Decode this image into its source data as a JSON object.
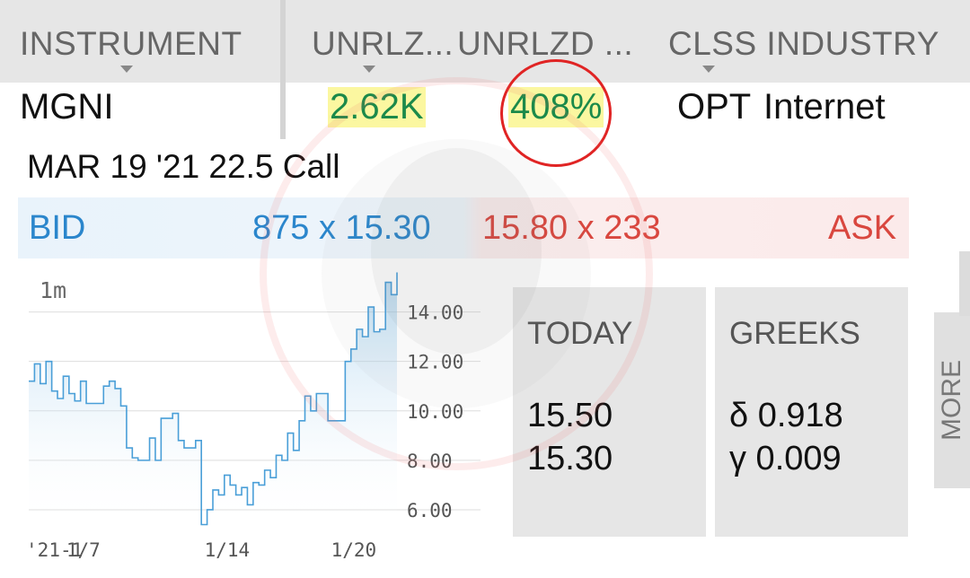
{
  "header": {
    "col_instrument": "INSTRUMENT",
    "col_unrlz_short": "UNRLZ...",
    "col_unrlzd": "UNRLZD ...",
    "col_clss_industry": "CLSS INDUSTRY"
  },
  "row": {
    "instrument": "MGNI",
    "unrlz": "2.62K",
    "unrlzd": "408%",
    "clss": "OPT",
    "industry": "Internet"
  },
  "contract": "MAR 19 '21 22.5 Call",
  "quote": {
    "bid_label": "BID",
    "bid_value": "875 x 15.30",
    "ask_value": "15.80 x 233",
    "ask_label": "ASK"
  },
  "chart_data": {
    "type": "area",
    "timeframe": "1m",
    "x_ticks": [
      "'21-1",
      "1/7",
      "1/14",
      "1/20"
    ],
    "y_ticks": [
      "14.00",
      "12.00",
      "10.00",
      "8.00",
      "6.00"
    ],
    "ylim": [
      5.2,
      15.8
    ],
    "grid": true,
    "series": [
      {
        "values": [
          11.2,
          11.9,
          11.1,
          12.0,
          10.8,
          10.5,
          11.4,
          10.7,
          10.4,
          11.2,
          10.3,
          10.3,
          10.3,
          11.0,
          11.2,
          10.9,
          10.2,
          8.5,
          8.1,
          8.0,
          8.0,
          8.9,
          8.0,
          9.7,
          9.7,
          9.9,
          8.8,
          8.5,
          8.5,
          8.8,
          5.4,
          6.0,
          6.8,
          6.6,
          7.4,
          7.0,
          6.6,
          6.9,
          6.2,
          7.1,
          7.0,
          7.6,
          7.3,
          8.2,
          8.0,
          9.1,
          8.4,
          9.6,
          10.6,
          10.0,
          10.7,
          10.7,
          9.6,
          9.6,
          9.6,
          12.0,
          12.5,
          13.3,
          13.0,
          14.2,
          13.2,
          13.3,
          15.2,
          14.7,
          15.6
        ]
      }
    ],
    "area_color": "#5aa8dc"
  },
  "today": {
    "title": "TODAY",
    "value1": "15.50",
    "value2": "15.30"
  },
  "greeks": {
    "title": "GREEKS",
    "delta": "δ 0.918",
    "gamma": "γ 0.009"
  },
  "more_label": "MORE",
  "colors": {
    "bid": "#2b86cc",
    "ask": "#d9473f",
    "highlight_bg": "#fbf7a0",
    "gain_text": "#1b8a4a",
    "circle": "#e02424"
  }
}
